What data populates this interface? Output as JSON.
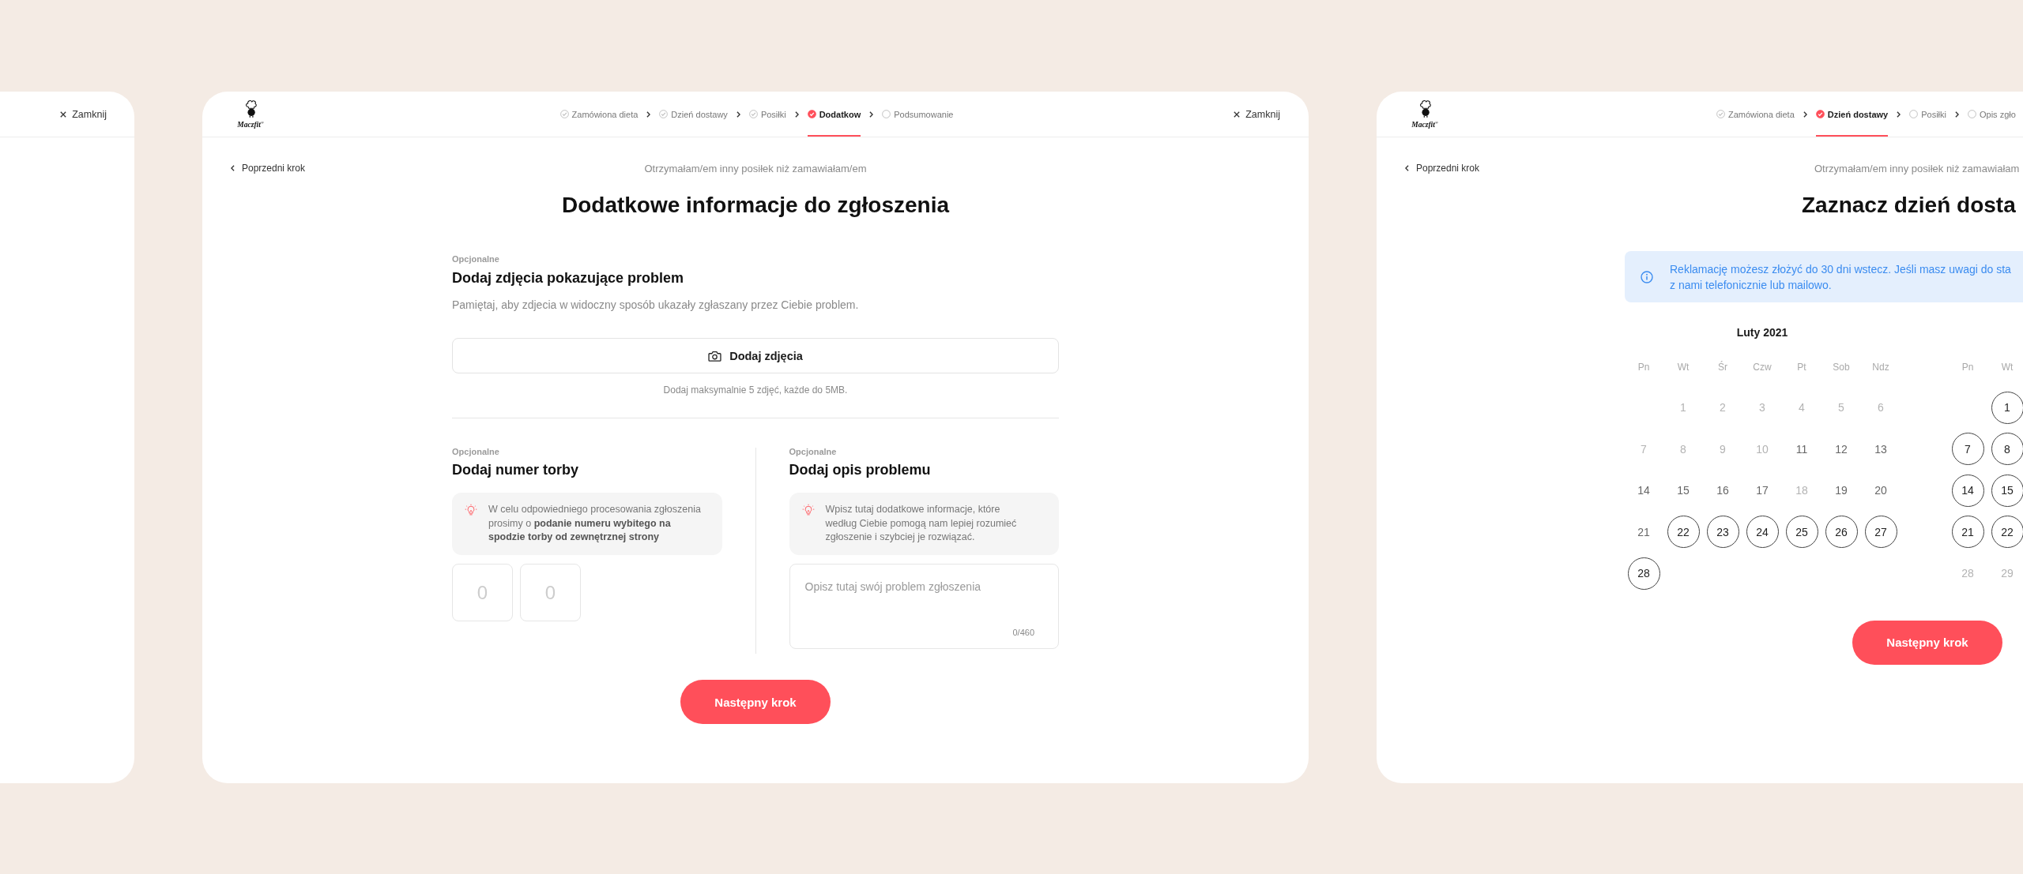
{
  "left_screen": {
    "close_label": "Zamknij"
  },
  "main_screen": {
    "logo_text": "Maczfit$^{®}$",
    "steps": [
      {
        "label": "Zamówiona dieta",
        "checked": true,
        "selected": false
      },
      {
        "label": "Dzień dostawy",
        "checked": true,
        "selected": false
      },
      {
        "label": "Posiłki",
        "checked": true,
        "selected": false
      },
      {
        "label": "Dodatkow",
        "checked": true,
        "selected": true
      },
      {
        "label": "Podsumowanie",
        "checked": false,
        "selected": false
      }
    ],
    "close_label": "Zamknij",
    "back_link": "Poprzedni krok",
    "subtitle": "Otrzymałam/em inny posiłek niż zamawiałam/em",
    "title": "Dodatkowe informacje do zgłoszenia",
    "photos": {
      "optional": "Opcjonalne",
      "heading": "Dodaj zdjęcia pokazujące problem",
      "description": "Pamiętaj, aby zdjecia w widoczny sposób ukazały zgłaszany przez Ciebie problem.",
      "button": "Dodaj zdjęcia",
      "hint": "Dodaj maksymalnie 5 zdjęć, każde do 5MB."
    },
    "bag_number": {
      "optional": "Opcjonalne",
      "heading": "Dodaj numer torby",
      "info": "W celu odpowiedniego procesowania zgłoszenia prosimy o **podanie numeru wybitego na spodzie torby od zewnętrznej strony**",
      "digits": [
        {
          "placeholder": "0"
        },
        {
          "placeholder": "0"
        }
      ]
    },
    "problem_description": {
      "optional": "Opcjonalne",
      "heading": "Dodaj opis problemu",
      "info": "Wpisz tutaj dodatkowe informacje, które według Ciebie pomogą nam lepiej rozumieć zgłoszenie i szybciej je rozwiązać.",
      "placeholder": "Opisz tutaj swój problem zgłoszenia",
      "counter": "0/460"
    },
    "next_button": "Następny krok"
  },
  "right_screen": {
    "logo_text": "Maczfit$^{®}$",
    "steps": [
      {
        "label": "Zamówiona dieta",
        "checked": true,
        "selected": false
      },
      {
        "label": "Dzień dostawy",
        "checked": true,
        "selected": true
      },
      {
        "label": "Posiłki",
        "checked": false,
        "selected": false
      },
      {
        "label": "Opis zgło",
        "checked": false,
        "selected": false
      }
    ],
    "back_link": "Poprzedni krok",
    "subtitle": "Otrzymałam/em inny posiłek niż zamawiałam",
    "title": "Zaznacz dzień dosta",
    "alert_lines": [
      "Reklamację możesz złożyć do 30 dni wstecz. Jeśli masz uwagi do sta",
      "z nami telefonicznie lub mailowo."
    ],
    "months": [
      {
        "title": "Luty 2021",
        "weekdays": [
          "Pn",
          "Wt",
          "Śr",
          "Czw",
          "Pt",
          "Sob",
          "Ndz"
        ],
        "weeks": [
          [
            {
              "label": "1",
              "available": false,
              "disabled": true
            },
            {
              "label": "2",
              "available": false,
              "disabled": true
            },
            {
              "label": "3",
              "available": false,
              "disabled": true
            },
            {
              "label": "4",
              "available": false,
              "disabled": true
            },
            {
              "label": "5",
              "available": false,
              "disabled": true
            },
            {
              "label": "6",
              "available": false,
              "disabled": true
            }
          ],
          [
            {
              "label": "7",
              "available": false,
              "disabled": true
            },
            {
              "label": "8",
              "available": false,
              "disabled": true
            },
            {
              "label": "9",
              "available": false,
              "disabled": true
            },
            {
              "label": "10",
              "available": false,
              "disabled": true
            },
            {
              "label": "11",
              "available": false,
              "disabled": false
            },
            {
              "label": "12",
              "available": false,
              "disabled": false
            },
            {
              "label": "13",
              "available": false,
              "disabled": false
            }
          ],
          [
            {
              "label": "14",
              "available": false,
              "disabled": false
            },
            {
              "label": "15",
              "available": false,
              "disabled": false
            },
            {
              "label": "16",
              "available": false,
              "disabled": false
            },
            {
              "label": "17",
              "available": false,
              "disabled": false
            },
            {
              "label": "18",
              "available": false,
              "disabled": true
            },
            {
              "label": "19",
              "available": false,
              "disabled": false
            },
            {
              "label": "20",
              "available": false,
              "disabled": false
            }
          ],
          [
            {
              "label": "21",
              "available": false,
              "disabled": false
            },
            {
              "label": "22",
              "available": true,
              "disabled": false
            },
            {
              "label": "23",
              "available": true,
              "disabled": false
            },
            {
              "label": "24",
              "available": true,
              "disabled": false
            },
            {
              "label": "25",
              "available": true,
              "disabled": false
            },
            {
              "label": "26",
              "available": true,
              "disabled": false
            },
            {
              "label": "27",
              "available": true,
              "disabled": false
            }
          ],
          [
            {
              "label": "28",
              "available": true,
              "disabled": false
            }
          ]
        ]
      },
      {
        "weekdays": [
          "Pn",
          "Wt"
        ],
        "weeks": [
          [
            {
              "label": "1",
              "available": true,
              "disabled": false
            }
          ],
          [
            {
              "label": "7",
              "available": true,
              "disabled": false
            },
            {
              "label": "8",
              "available": true,
              "disabled": false
            }
          ],
          [
            {
              "label": "14",
              "available": true,
              "disabled": false
            },
            {
              "label": "15",
              "available": true,
              "disabled": false
            }
          ],
          [
            {
              "label": "21",
              "available": true,
              "disabled": false
            },
            {
              "label": "22",
              "available": true,
              "disabled": false
            }
          ],
          [
            {
              "label": "28",
              "available": false,
              "disabled": true
            },
            {
              "label": "29",
              "available": false,
              "disabled": true
            }
          ]
        ]
      }
    ],
    "next_button": "Następny krok"
  }
}
